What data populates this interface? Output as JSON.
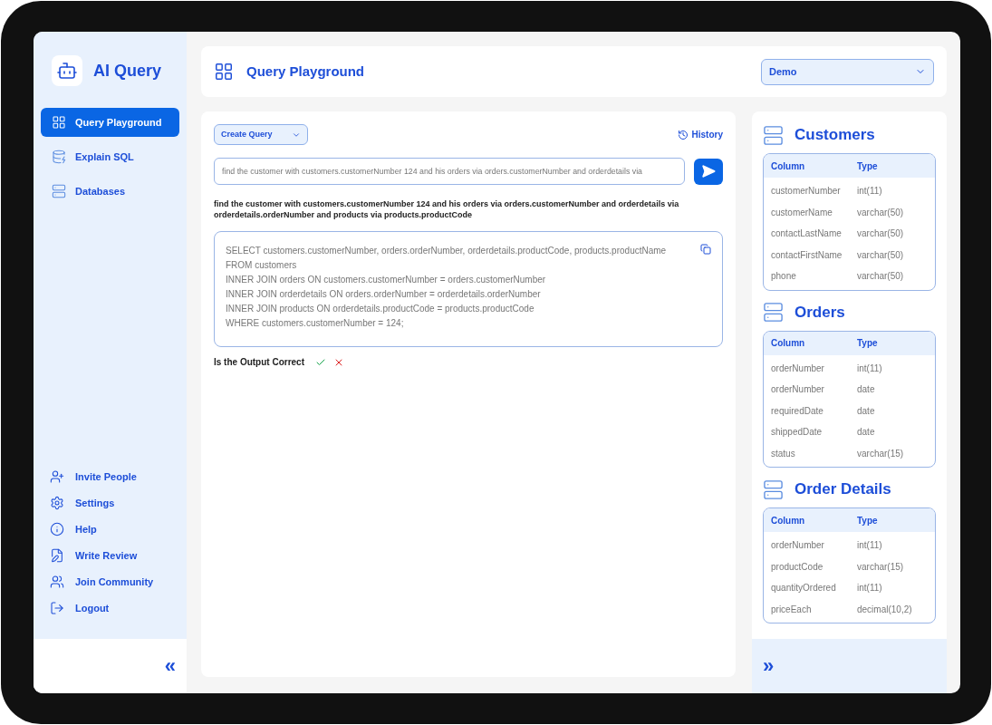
{
  "app": {
    "name": "AI Query"
  },
  "sidebar": {
    "items": [
      {
        "label": "Query Playground",
        "kind": "grid",
        "selected": true
      },
      {
        "label": "Explain SQL",
        "kind": "sql",
        "selected": false
      },
      {
        "label": "Databases",
        "kind": "server",
        "selected": false
      }
    ],
    "footer_items": [
      {
        "label": "Invite People",
        "kind": "user-plus"
      },
      {
        "label": "Settings",
        "kind": "settings"
      },
      {
        "label": "Help",
        "kind": "info"
      },
      {
        "label": "Write Review",
        "kind": "review"
      },
      {
        "label": "Join Community",
        "kind": "users"
      },
      {
        "label": "Logout",
        "kind": "logout"
      }
    ],
    "collapse": "«"
  },
  "header": {
    "title": "Query Playground",
    "database_select": "Demo"
  },
  "playground": {
    "mode_select": "Create Query",
    "history": "History",
    "query_input": {
      "value": "find the customer with customers.customerNumber 124 and his orders via orders.customerNumber and orderdetails via"
    },
    "prompt": "find the customer with customers.customerNumber 124 and his orders via orders.customerNumber and orderdetails via orderdetails.orderNumber and products via products.productCode",
    "sql": [
      "SELECT customers.customerNumber, orders.orderNumber, orderdetails.productCode, products.productName",
      "FROM customers",
      "INNER JOIN orders ON customers.customerNumber = orders.customerNumber",
      "INNER JOIN orderdetails ON orders.orderNumber = orderdetails.orderNumber",
      "INNER JOIN products ON orderdetails.productCode = products.productCode",
      "WHERE customers.customerNumber = 124;"
    ],
    "feedback": "Is the Output Correct"
  },
  "schema": {
    "tables": [
      {
        "name": "Customers",
        "columns": [
          "Column",
          "Type"
        ],
        "rows": [
          [
            "customerNumber",
            "int(11)"
          ],
          [
            "customerName",
            "varchar(50)"
          ],
          [
            "contactLastName",
            "varchar(50)"
          ],
          [
            "contactFirstName",
            "varchar(50)"
          ],
          [
            "phone",
            "varchar(50)"
          ]
        ]
      },
      {
        "name": "Orders",
        "columns": [
          "Column",
          "Type"
        ],
        "rows": [
          [
            "orderNumber",
            "int(11)"
          ],
          [
            "orderNumber",
            "date"
          ],
          [
            "requiredDate",
            "date"
          ],
          [
            "shippedDate",
            "date"
          ],
          [
            "status",
            "varchar(15)"
          ]
        ]
      },
      {
        "name": "Order Details",
        "columns": [
          "Column",
          "Type"
        ],
        "rows": [
          [
            "orderNumber",
            "int(11)"
          ],
          [
            "productCode",
            "varchar(15)"
          ],
          [
            "quantityOrdered",
            "int(11)"
          ],
          [
            "priceEach",
            "decimal(10,2)"
          ]
        ]
      }
    ],
    "expand": "»"
  }
}
